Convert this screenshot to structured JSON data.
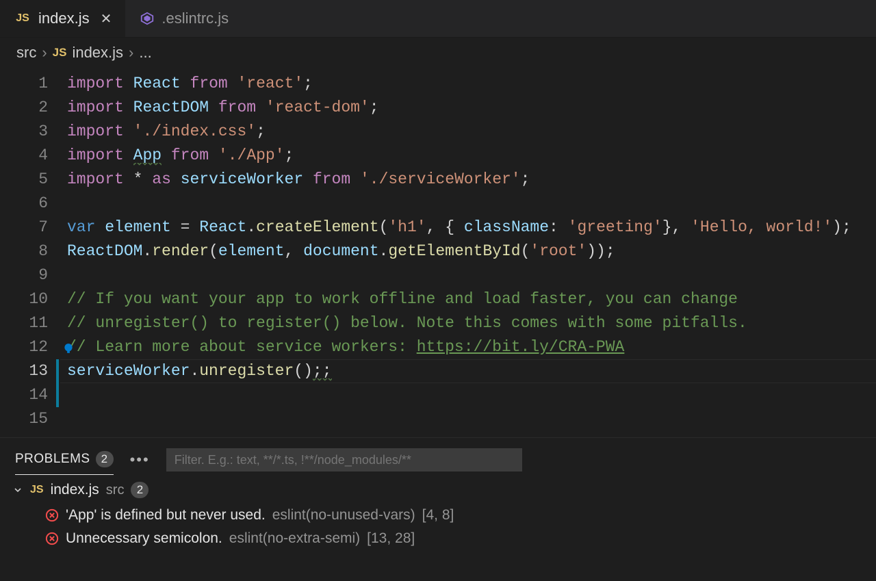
{
  "tabs": [
    {
      "icon": "js",
      "label": "index.js",
      "active": true,
      "closeable": true
    },
    {
      "icon": "eslint",
      "label": ".eslintrc.js",
      "active": false,
      "closeable": false
    }
  ],
  "breadcrumb": {
    "parts": [
      "src",
      "index.js",
      "..."
    ],
    "fileIcon": "js"
  },
  "editor": {
    "currentLine": 13,
    "dirtyRange": [
      13,
      14
    ],
    "lines": [
      {
        "n": 1,
        "tokens": [
          [
            "kw",
            "import"
          ],
          [
            "punc",
            " "
          ],
          [
            "id",
            "React"
          ],
          [
            "punc",
            " "
          ],
          [
            "kw",
            "from"
          ],
          [
            "punc",
            " "
          ],
          [
            "str",
            "'react'"
          ],
          [
            "punc",
            ";"
          ]
        ]
      },
      {
        "n": 2,
        "tokens": [
          [
            "kw",
            "import"
          ],
          [
            "punc",
            " "
          ],
          [
            "id",
            "ReactDOM"
          ],
          [
            "punc",
            " "
          ],
          [
            "kw",
            "from"
          ],
          [
            "punc",
            " "
          ],
          [
            "str",
            "'react-dom'"
          ],
          [
            "punc",
            ";"
          ]
        ]
      },
      {
        "n": 3,
        "tokens": [
          [
            "kw",
            "import"
          ],
          [
            "punc",
            " "
          ],
          [
            "str",
            "'./index.css'"
          ],
          [
            "punc",
            ";"
          ]
        ]
      },
      {
        "n": 4,
        "tokens": [
          [
            "kw",
            "import"
          ],
          [
            "punc",
            " "
          ],
          [
            "id squig",
            "App"
          ],
          [
            "punc",
            " "
          ],
          [
            "kw",
            "from"
          ],
          [
            "punc",
            " "
          ],
          [
            "str",
            "'./App'"
          ],
          [
            "punc",
            ";"
          ]
        ]
      },
      {
        "n": 5,
        "tokens": [
          [
            "kw",
            "import"
          ],
          [
            "punc",
            " "
          ],
          [
            "op",
            "*"
          ],
          [
            "punc",
            " "
          ],
          [
            "kw",
            "as"
          ],
          [
            "punc",
            " "
          ],
          [
            "id",
            "serviceWorker"
          ],
          [
            "punc",
            " "
          ],
          [
            "kw",
            "from"
          ],
          [
            "punc",
            " "
          ],
          [
            "str",
            "'./serviceWorker'"
          ],
          [
            "punc",
            ";"
          ]
        ]
      },
      {
        "n": 6,
        "tokens": []
      },
      {
        "n": 7,
        "tokens": [
          [
            "var",
            "var"
          ],
          [
            "punc",
            " "
          ],
          [
            "id",
            "element"
          ],
          [
            "punc",
            " "
          ],
          [
            "op",
            "="
          ],
          [
            "punc",
            " "
          ],
          [
            "id",
            "React"
          ],
          [
            "punc",
            "."
          ],
          [
            "fn",
            "createElement"
          ],
          [
            "punc",
            "("
          ],
          [
            "str",
            "'h1'"
          ],
          [
            "punc",
            ", { "
          ],
          [
            "id",
            "className"
          ],
          [
            "punc",
            ": "
          ],
          [
            "str",
            "'greeting'"
          ],
          [
            "punc",
            "}, "
          ],
          [
            "str",
            "'Hello, world!'"
          ],
          [
            "punc",
            ");"
          ]
        ]
      },
      {
        "n": 8,
        "tokens": [
          [
            "id",
            "ReactDOM"
          ],
          [
            "punc",
            "."
          ],
          [
            "fn",
            "render"
          ],
          [
            "punc",
            "("
          ],
          [
            "id",
            "element"
          ],
          [
            "punc",
            ", "
          ],
          [
            "id",
            "document"
          ],
          [
            "punc",
            "."
          ],
          [
            "fn",
            "getElementById"
          ],
          [
            "punc",
            "("
          ],
          [
            "str",
            "'root'"
          ],
          [
            "punc",
            "));"
          ]
        ]
      },
      {
        "n": 9,
        "tokens": []
      },
      {
        "n": 10,
        "tokens": [
          [
            "com",
            "// If you want your app to work offline and load faster, you can change"
          ]
        ]
      },
      {
        "n": 11,
        "tokens": [
          [
            "com",
            "// unregister() to register() below. Note this comes with some pitfalls."
          ]
        ]
      },
      {
        "n": 12,
        "bulb": true,
        "tokens": [
          [
            "com",
            "// Learn more about service workers: "
          ],
          [
            "link",
            "https://bit.ly/CRA-PWA"
          ]
        ]
      },
      {
        "n": 13,
        "tokens": [
          [
            "id",
            "serviceWorker"
          ],
          [
            "punc",
            "."
          ],
          [
            "fn",
            "unregister"
          ],
          [
            "punc",
            "()"
          ],
          [
            "punc squig",
            ";;"
          ]
        ]
      },
      {
        "n": 14,
        "tokens": []
      },
      {
        "n": 15,
        "tokens": []
      }
    ]
  },
  "panel": {
    "tabLabel": "PROBLEMS",
    "tabCount": "2",
    "ellipsis": "•••",
    "filterPlaceholder": "Filter. E.g.: text, **/*.ts, !**/node_modules/**",
    "file": {
      "icon": "js",
      "name": "index.js",
      "folder": "src",
      "count": "2"
    },
    "problems": [
      {
        "message": "'App' is defined but never used.",
        "rule": "eslint(no-unused-vars)",
        "pos": "[4, 8]"
      },
      {
        "message": "Unnecessary semicolon.",
        "rule": "eslint(no-extra-semi)",
        "pos": "[13, 28]"
      }
    ]
  }
}
